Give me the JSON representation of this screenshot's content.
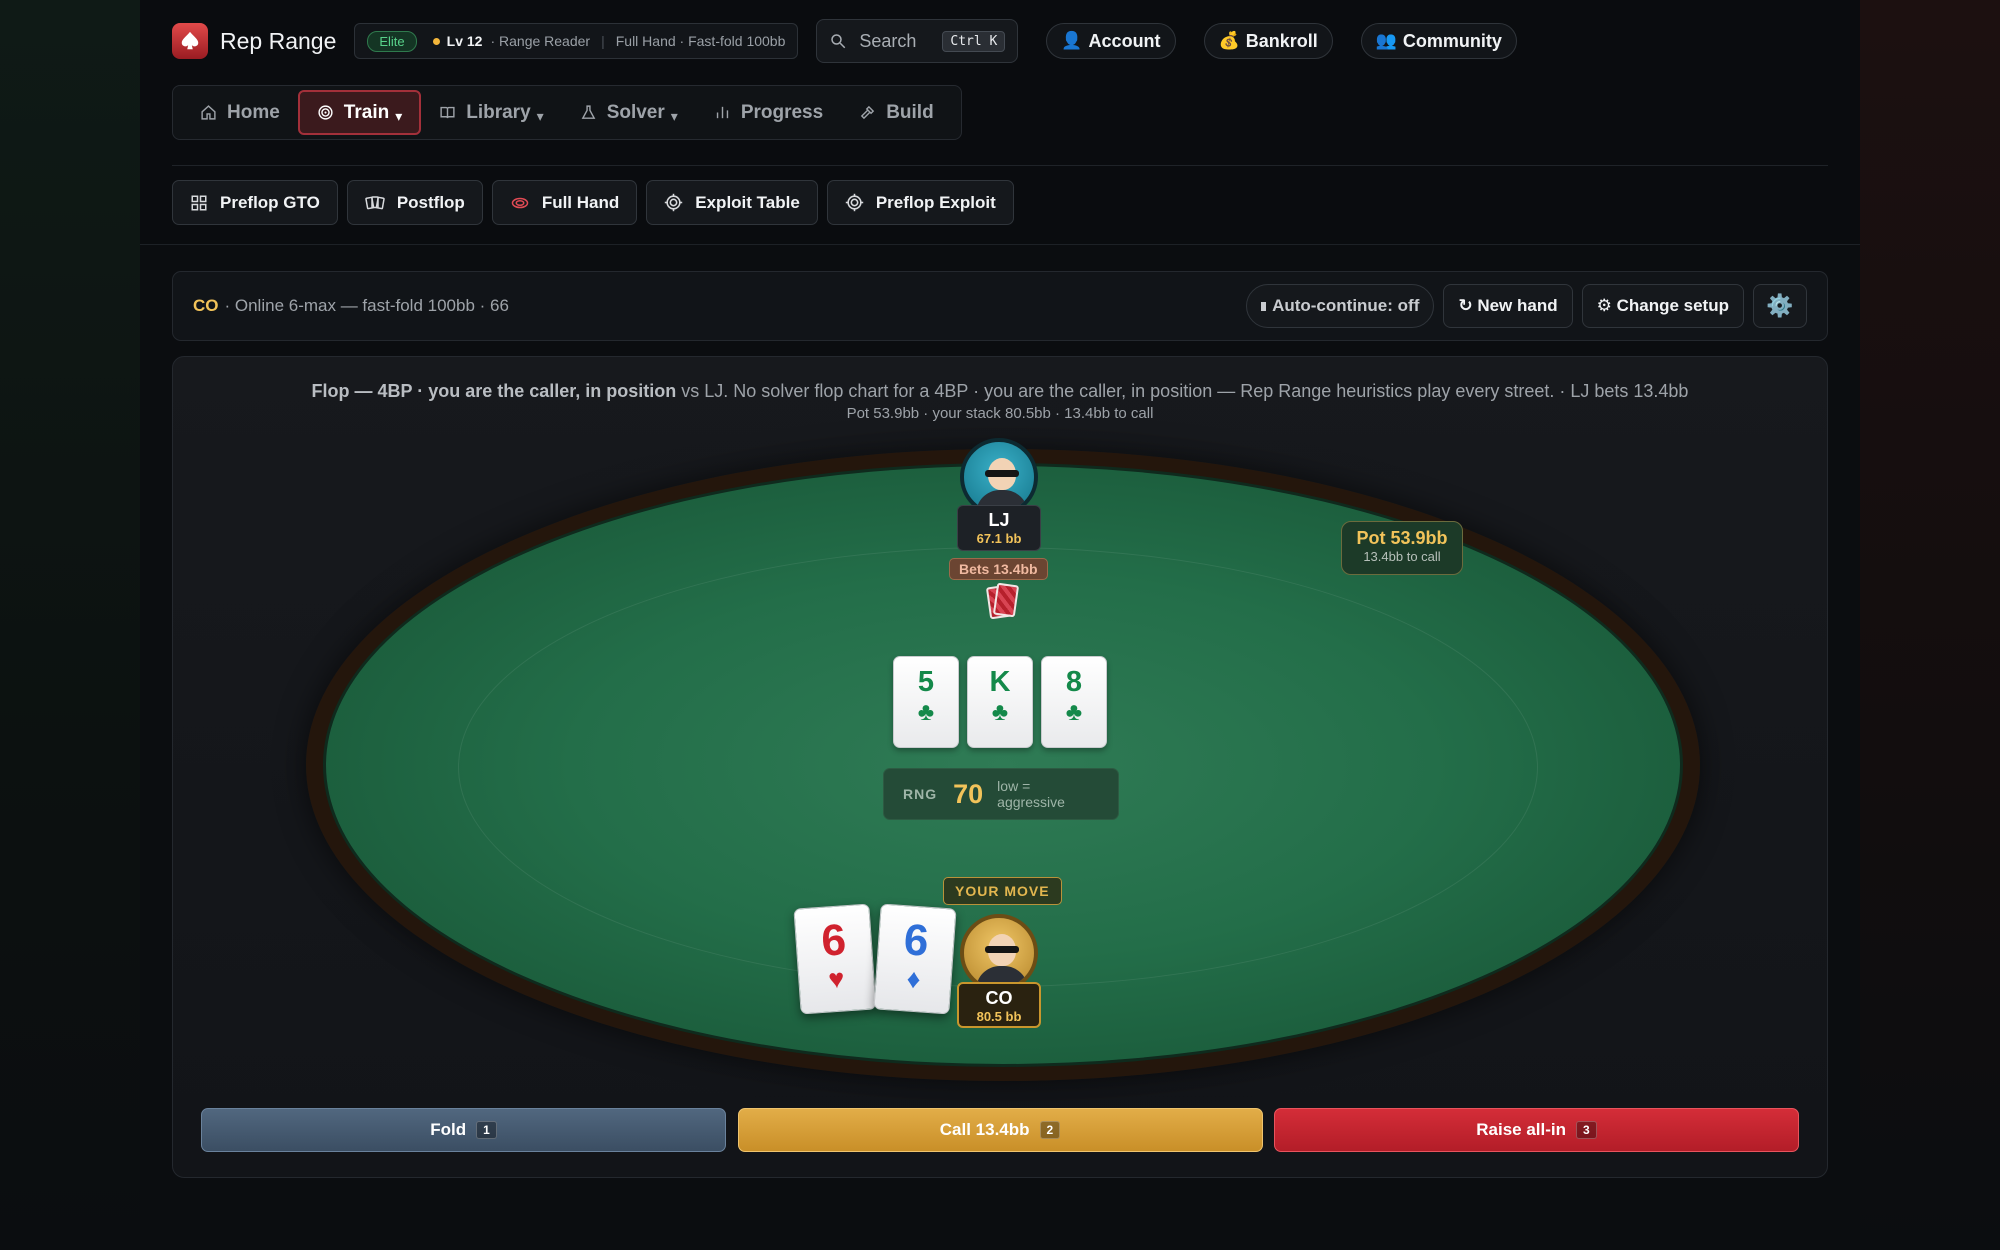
{
  "app": {
    "title": "Rep Range",
    "tier_badge": "Elite",
    "level": "Lv 12",
    "rank": "· Range Reader",
    "mode_summary": "Full Hand · Fast-fold 100bb"
  },
  "search": {
    "label": "Search",
    "shortcut": "Ctrl K"
  },
  "top_links": [
    {
      "label": "Account",
      "icon": "user-icon"
    },
    {
      "label": "Bankroll",
      "icon": "money-bag-icon"
    },
    {
      "label": "Community",
      "icon": "people-icon"
    }
  ],
  "nav": [
    {
      "label": "Home",
      "icon": "home-icon"
    },
    {
      "label": "Train",
      "icon": "target-icon",
      "active": true,
      "dropdown": true
    },
    {
      "label": "Library",
      "icon": "book-icon",
      "dropdown": true
    },
    {
      "label": "Solver",
      "icon": "flask-icon",
      "dropdown": true
    },
    {
      "label": "Progress",
      "icon": "bar-chart-icon"
    },
    {
      "label": "Build",
      "icon": "hammer-icon"
    }
  ],
  "modes": [
    {
      "label": "Preflop GTO",
      "icon": "grid-icon"
    },
    {
      "label": "Postflop",
      "icon": "cards-icon"
    },
    {
      "label": "Full Hand",
      "icon": "chip-icon"
    },
    {
      "label": "Exploit Table",
      "icon": "crosshair-icon"
    },
    {
      "label": "Preflop Exploit",
      "icon": "crosshair-icon"
    }
  ],
  "infobar": {
    "position": "CO",
    "description": "· Online 6-max — fast-fold 100bb · 66",
    "auto_continue": "Auto-continue: off",
    "new_hand": "↻ New hand",
    "change_setup": "⚙ Change setup",
    "settings_icon": "⚙️"
  },
  "table": {
    "headline_bold": "Flop — 4BP · you are the caller, in position",
    "headline_rest": " vs LJ. No solver flop chart for a 4BP · you are the caller, in position — Rep Range heuristics play every street. · LJ bets 13.4bb",
    "subline": "Pot 53.9bb · your stack 80.5bb · 13.4bb to call",
    "villain": {
      "name": "LJ",
      "stack": "67.1 bb",
      "bet_label": "Bets 13.4bb"
    },
    "hero": {
      "name": "CO",
      "stack": "80.5 bb",
      "prompt": "YOUR MOVE"
    },
    "pot": {
      "label": "Pot 53.9bb",
      "to_call": "13.4bb to call"
    },
    "board": [
      {
        "rank": "5",
        "suit": "♣"
      },
      {
        "rank": "K",
        "suit": "♣"
      },
      {
        "rank": "8",
        "suit": "♣"
      }
    ],
    "hole_cards": [
      {
        "rank": "6",
        "suit": "♥"
      },
      {
        "rank": "6",
        "suit": "♦"
      }
    ],
    "rng": {
      "label": "RNG",
      "value": "70",
      "hint": "low = aggressive"
    }
  },
  "actions": [
    {
      "label": "Fold",
      "key": "1"
    },
    {
      "label": "Call 13.4bb",
      "key": "2"
    },
    {
      "label": "Raise all-in",
      "key": "3"
    }
  ],
  "colors": {
    "accent": "#a3303a",
    "gold": "#f2c35a",
    "felt": "#236e49"
  }
}
